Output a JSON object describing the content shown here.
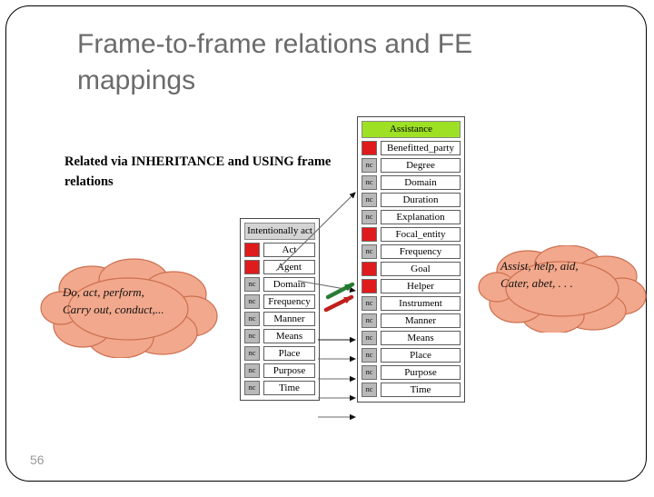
{
  "slide": {
    "title": "Frame-to-frame relations and FE mappings",
    "number": "56",
    "note": "Related via INHERITANCE and USING frame relations",
    "title_color": "#6b6b6b",
    "border_color": "#000000"
  },
  "clouds": {
    "left": {
      "name": "lexical-units-intentionally-act",
      "line1": "Do, act, perform,",
      "line2": "Carry out, conduct,...",
      "fill": "#f2a88c",
      "stroke": "#c2674a"
    },
    "right": {
      "name": "lexical-units-assistance",
      "line1": "Assist, help, aid,",
      "line2": "Cater, abet, . . .",
      "fill": "#f2a88c",
      "stroke": "#c2674a"
    }
  },
  "tables": {
    "left": {
      "header": "Intentionally act",
      "header_color": "#d4d4d4",
      "rows": [
        {
          "tag": "c",
          "fe": "Act"
        },
        {
          "tag": "c",
          "fe": "Agent"
        },
        {
          "tag": "nc",
          "fe": "Domain"
        },
        {
          "tag": "nc",
          "fe": "Frequency"
        },
        {
          "tag": "nc",
          "fe": "Manner"
        },
        {
          "tag": "nc",
          "fe": "Means"
        },
        {
          "tag": "nc",
          "fe": "Place"
        },
        {
          "tag": "nc",
          "fe": "Purpose"
        },
        {
          "tag": "nc",
          "fe": "Time"
        }
      ]
    },
    "right": {
      "header": "Assistance",
      "header_color": "#9de024",
      "rows": [
        {
          "tag": "c",
          "fe": "Benefitted_party"
        },
        {
          "tag": "nc",
          "fe": "Degree"
        },
        {
          "tag": "nc",
          "fe": "Domain"
        },
        {
          "tag": "nc",
          "fe": "Duration"
        },
        {
          "tag": "nc",
          "fe": "Explanation"
        },
        {
          "tag": "c",
          "fe": "Focal_entity"
        },
        {
          "tag": "nc",
          "fe": "Frequency"
        },
        {
          "tag": "c",
          "fe": "Goal"
        },
        {
          "tag": "c",
          "fe": "Helper"
        },
        {
          "tag": "nc",
          "fe": "Instrument"
        },
        {
          "tag": "nc",
          "fe": "Manner"
        },
        {
          "tag": "nc",
          "fe": "Means"
        },
        {
          "tag": "nc",
          "fe": "Place"
        },
        {
          "tag": "nc",
          "fe": "Purpose"
        },
        {
          "tag": "nc",
          "fe": "Time"
        }
      ]
    }
  },
  "legend_tags": {
    "core": "c",
    "non_core": "nc"
  },
  "connector_colors": {
    "mapping": "#555555",
    "green_arrow": "#1f7a2e",
    "red_arrow": "#c0201c"
  }
}
